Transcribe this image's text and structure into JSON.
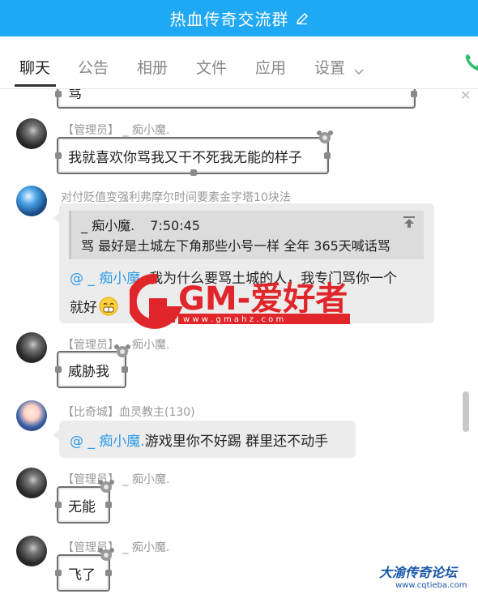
{
  "window": {
    "title": "热血传奇交流群"
  },
  "tabs": [
    {
      "label": "聊天",
      "active": true
    },
    {
      "label": "公告"
    },
    {
      "label": "相册"
    },
    {
      "label": "文件"
    },
    {
      "label": "应用"
    },
    {
      "label": "设置"
    }
  ],
  "icons": {
    "edit": "pencil-icon",
    "settings_dropdown": "chevron-down-icon",
    "call": "phone-icon",
    "close": "close-icon",
    "quote_jump": "arrow-up-to-top-icon",
    "emoji": "grin-face-icon"
  },
  "colors": {
    "header": "#1fa8f3",
    "mention": "#2d9bea",
    "bubble": "#ececec"
  },
  "messages": [
    {
      "type": "partial",
      "text": "骂"
    },
    {
      "sender": "【管理员】 _ 痴小魔.",
      "text": "我就喜欢你骂我又干不死我无能的样子"
    },
    {
      "sender": "对付贬值变强利弗摩尔时间要素金字塔10块法",
      "quote": {
        "author": "_ 痴小魔.",
        "time": "7:50:45",
        "text": "骂  最好是土城左下角那些小号一样 全年 365天喊话骂"
      },
      "mention": "@ _ 痴小魔.",
      "text_line1": " 我为什么要骂土城的人，我专门骂你一个",
      "text_line2": "就好"
    },
    {
      "sender": "【管理员】 _ 痴小魔.",
      "text": "威胁我"
    },
    {
      "sender": "【比奇城】血灵教主(130)",
      "mention": "@ _ 痴小魔.",
      "text": " 游戏里你不好踢 群里还不动手"
    },
    {
      "sender": "【管理员】 _ 痴小魔.",
      "text": "无能"
    },
    {
      "sender": "【管理员】 _ 痴小魔.",
      "text": "飞了"
    }
  ],
  "watermark": {
    "text": "GM-爱好者",
    "url": "w w w . g m a h z . c o m"
  },
  "footer": {
    "brand": "大渝传奇论坛",
    "url": "www.cqtieba.com"
  }
}
